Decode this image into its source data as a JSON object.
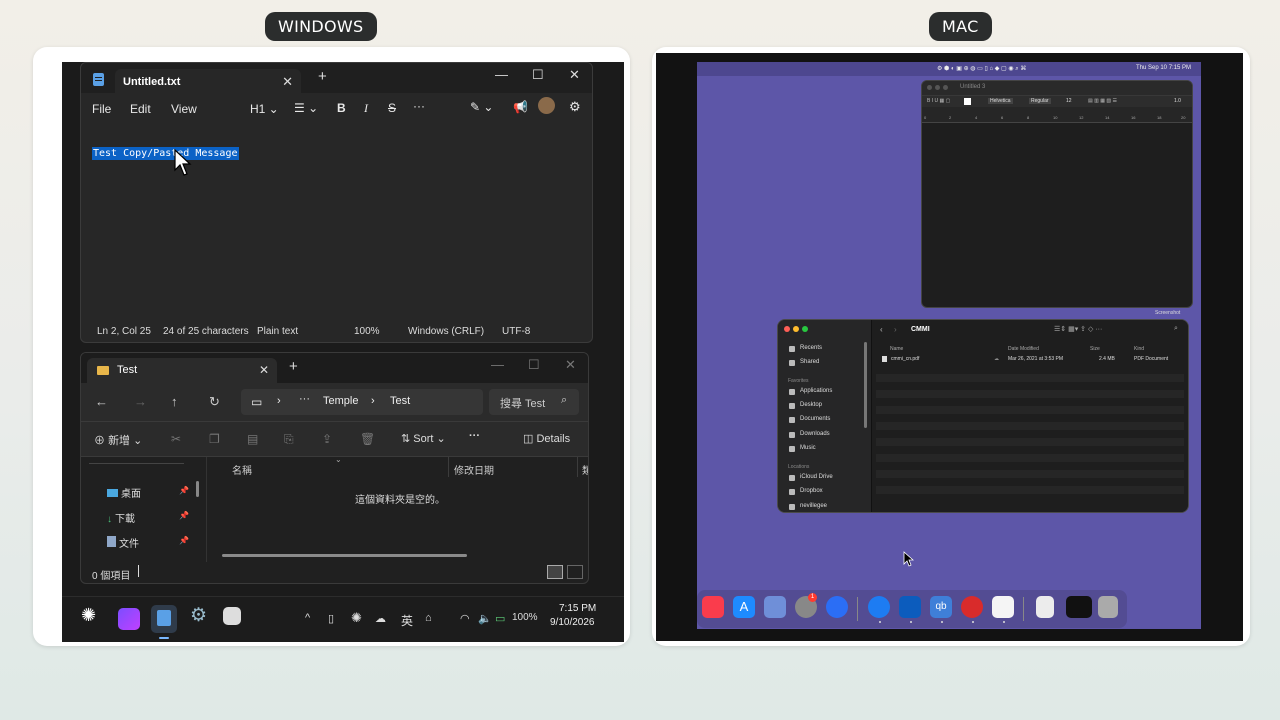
{
  "labels": {
    "windows": "WINDOWS",
    "mac": "MAC"
  },
  "notepad": {
    "tab_title": "Untitled.txt",
    "menu": [
      "File",
      "Edit",
      "View"
    ],
    "heading_selector": "H1",
    "content": "Test Copy/Pasted Message",
    "status": {
      "position": "Ln 2, Col 25",
      "chars": "24 of 25 characters",
      "format": "Plain text",
      "zoom": "100%",
      "line_ending": "Windows (CRLF)",
      "encoding": "UTF-8"
    }
  },
  "explorer": {
    "tab_title": "Test",
    "breadcrumb": [
      "Temple",
      "Test"
    ],
    "search_placeholder": "搜尋 Test",
    "new_label": "新增",
    "sort_label": "Sort",
    "details_label": "Details",
    "sidebar": [
      "桌面",
      "下載",
      "文件"
    ],
    "columns": [
      "名稱",
      "修改日期",
      "類"
    ],
    "empty_message": "這個資料夾是空的。",
    "status": "0 個項目"
  },
  "taskbar": {
    "ime": "英",
    "battery": "100%",
    "time": "7:15 PM",
    "date": "9/10/2026"
  },
  "mac": {
    "menubar_clock": "Thu Sep 10  7:15 PM",
    "textedit": {
      "title": "Untitled 3",
      "font": "Helvetica",
      "style": "Regular",
      "size": "12",
      "spacing": "1.0",
      "ruler": [
        "0",
        "2",
        "4",
        "6",
        "8",
        "10",
        "12",
        "14",
        "16",
        "18",
        "20"
      ]
    },
    "desktop_file": "Screenshot",
    "finder": {
      "title": "CMMI",
      "sidebar": {
        "top": [
          "Recents",
          "Shared"
        ],
        "favorites_header": "Favorites",
        "favorites": [
          "Applications",
          "Desktop",
          "Documents",
          "Downloads",
          "Music"
        ],
        "locations_header": "Locations",
        "locations": [
          "iCloud Drive",
          "Dropbox",
          "nevillegee"
        ]
      },
      "columns": [
        "Name",
        "Date Modified",
        "Size",
        "Kind"
      ],
      "file": {
        "name": "cmmi_cn.pdf",
        "date": "Mar 26, 2021 at 3:53 PM",
        "size": "2.4 MB",
        "kind": "PDF Document"
      }
    },
    "dock_badge": "1"
  },
  "colors": {
    "accent": "#0b62c6",
    "mac_wallpaper": "#5d56a8"
  }
}
